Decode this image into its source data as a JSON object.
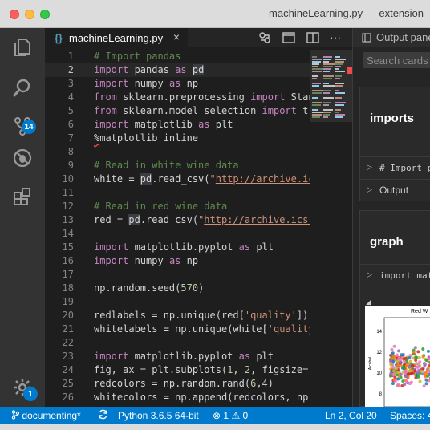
{
  "window": {
    "title": "machineLearning.py — extension"
  },
  "activity_bar": {
    "items": [
      {
        "name": "explorer-icon"
      },
      {
        "name": "search-icon"
      },
      {
        "name": "source-control-icon",
        "badge": "14"
      },
      {
        "name": "debug-icon"
      },
      {
        "name": "extensions-icon"
      }
    ],
    "settings": {
      "name": "settings-gear-icon",
      "badge": "1"
    }
  },
  "editor": {
    "tab": {
      "label": "machineLearning.py",
      "close": "×",
      "icon": "{}"
    },
    "toolbar": [
      "open-changes-icon",
      "open-preview-icon",
      "split-editor-icon",
      "more-actions-icon"
    ],
    "more_label": "···",
    "current_line": 2,
    "lines": [
      {
        "n": "1",
        "html": "<span class=\"c\"># Import pandas</span>"
      },
      {
        "n": "2",
        "html": "<span class=\"k\">import</span> pandas <span class=\"k\">as</span> <span class=\"hl\">pd</span>"
      },
      {
        "n": "3",
        "html": "<span class=\"k\">import</span> numpy <span class=\"k\">as</span> np"
      },
      {
        "n": "4",
        "html": "<span class=\"k\">from</span> sklearn.preprocessing <span class=\"k\">import</span> Stand"
      },
      {
        "n": "5",
        "html": "<span class=\"k\">from</span> sklearn.model_selection <span class=\"k\">import</span> tra"
      },
      {
        "n": "6",
        "html": "<span class=\"k\">import</span> matplotlib <span class=\"k\">as</span> plt"
      },
      {
        "n": "7",
        "html": "<span class=\"squig\">%</span>matplotlib inline"
      },
      {
        "n": "8",
        "html": ""
      },
      {
        "n": "9",
        "html": "<span class=\"c\"># Read in white wine data</span>"
      },
      {
        "n": "10",
        "html": "white = <span class=\"hl\">pd</span>.read_csv(<span class=\"s\">\"<u>http://archive.ics</u></span>"
      },
      {
        "n": "11",
        "html": ""
      },
      {
        "n": "12",
        "html": "<span class=\"c\"># Read in red wine data</span>"
      },
      {
        "n": "13",
        "html": "red = <span class=\"hl\">pd</span>.read_csv(<span class=\"s\">\"<u>http://archive.ics.u</u></span>"
      },
      {
        "n": "14",
        "html": ""
      },
      {
        "n": "15",
        "html": "<span class=\"k\">import</span> matplotlib.pyplot <span class=\"k\">as</span> plt"
      },
      {
        "n": "16",
        "html": "<span class=\"k\">import</span> numpy <span class=\"k\">as</span> np"
      },
      {
        "n": "17",
        "html": ""
      },
      {
        "n": "18",
        "html": "np.random.seed(<span class=\"n\">570</span>)"
      },
      {
        "n": "19",
        "html": ""
      },
      {
        "n": "20",
        "html": "redlabels = np.unique(red[<span class=\"s\">'quality'</span>])"
      },
      {
        "n": "21",
        "html": "whitelabels = np.unique(white[<span class=\"s\">'quality'</span>"
      },
      {
        "n": "22",
        "html": ""
      },
      {
        "n": "23",
        "html": "<span class=\"k\">import</span> matplotlib.pyplot <span class=\"k\">as</span> plt"
      },
      {
        "n": "24",
        "html": "fig, ax = plt.subplots(<span class=\"n\">1</span>, <span class=\"n\">2</span>, figsize=(<span class=\"n\">8</span>"
      },
      {
        "n": "25",
        "html": "redcolors = np.random.rand(<span class=\"n\">6</span>,<span class=\"n\">4</span>)"
      },
      {
        "n": "26",
        "html": "whitecolors = np.append(redcolors, np.r"
      }
    ]
  },
  "panel": {
    "title": "Output pane",
    "title_icon": "output-icon",
    "search_placeholder": "Search cards",
    "cards": [
      {
        "title": "imports",
        "rows": [
          {
            "text": "# Import pa",
            "mono": true
          },
          {
            "text": "Output",
            "mono": false
          }
        ]
      },
      {
        "title": "graph",
        "rows": [
          {
            "text": "import matp",
            "mono": true
          }
        ]
      }
    ],
    "plot": {
      "title": "Red W",
      "ylabel": "Alcohol",
      "yticks": [
        "14",
        "12",
        "10",
        "8"
      ],
      "point_colors": [
        "#2ca02c",
        "#d62728",
        "#ff7f0e",
        "#9467bd",
        "#e377c2",
        "#1f77b4",
        "#bcbd22",
        "#ff69b4"
      ]
    }
  },
  "status": {
    "branch": "documenting*",
    "sync_icon": "sync-icon",
    "python": "Python 3.6.5 64-bit",
    "errors": "1",
    "warnings": "0",
    "position": "Ln 2, Col 20",
    "spaces": "Spaces: 4"
  }
}
